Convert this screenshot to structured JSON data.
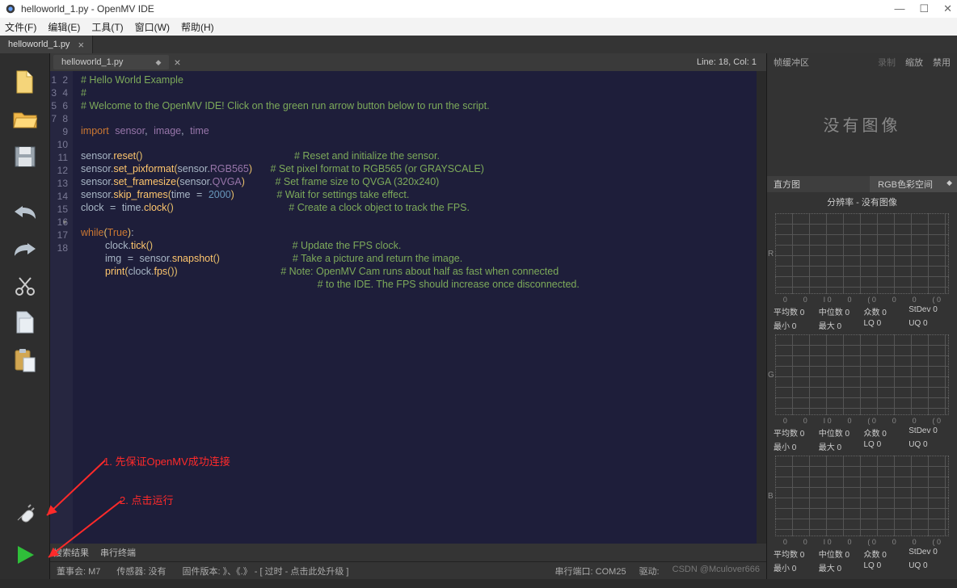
{
  "title": "helloworld_1.py - OpenMV IDE",
  "menu": {
    "file": "文件(F)",
    "edit": "编辑(E)",
    "tools": "工具(T)",
    "window": "窗口(W)",
    "help": "帮助(H)"
  },
  "tab": {
    "name": "helloworld_1.py"
  },
  "filehdr": {
    "name": "helloworld_1.py",
    "pos": "Line: 18, Col: 1"
  },
  "gutter_lines": [
    "1",
    "2",
    "3",
    "4",
    "5",
    "6",
    "7",
    "8",
    "9",
    "10",
    "11",
    "12",
    "13",
    "14",
    "15",
    "16",
    "17",
    "18"
  ],
  "code": {
    "l1": "# Hello World Example",
    "l2": "#",
    "l3": "# Welcome to the OpenMV IDE! Click on the green run arrow button below to run the script.",
    "l5_kw": "import",
    "l5_m1": "sensor",
    "l5_m2": "image",
    "l5_m3": "time",
    "l7": "sensor.reset()",
    "l7c": "# Reset and initialize the sensor.",
    "l8a": "sensor.set_pixformat(sensor.RGB565)",
    "l8c": "# Set pixel format to RGB565 (or GRAYSCALE)",
    "l9a": "sensor.set_framesize(sensor.QVGA)",
    "l9c": "# Set frame size to QVGA (320x240)",
    "l10a": "sensor.skip_frames(time = 2000)",
    "l10c": "# Wait for settings take effect.",
    "l11a": "clock = time.clock()",
    "l11c": "# Create a clock object to track the FPS.",
    "l13": "while(True):",
    "l14a": "    clock.tick()",
    "l14c": "# Update the FPS clock.",
    "l15a": "    img = sensor.snapshot()",
    "l15c": "# Take a picture and return the image.",
    "l16a": "    print(clock.fps())",
    "l16c": "# Note: OpenMV Cam runs about half as fast when connected",
    "l17c": "# to the IDE. The FPS should increase once disconnected."
  },
  "bottom": {
    "search": "搜索结果",
    "serial": "串行终端"
  },
  "footer": {
    "board": "董事会:   M7",
    "sensor": "传感器:  没有",
    "fw": "固件版本:  》、《.》 - [ 过时 - 点击此处升级 ]",
    "port": "串行端口:  COM25",
    "drive": "驱动:",
    "watermark": "CSDN @Mculover666"
  },
  "right": {
    "hdr_title": "帧缓冲区",
    "hdr_rec": "录制",
    "hdr_zoom": "缩放",
    "hdr_disable": "禁用",
    "noimg": "没有图像",
    "hist_l": "直方图",
    "hist_r": "RGB色彩空间",
    "res": "分辨率 - 没有图像",
    "axis": [
      "0",
      "0",
      "I 0",
      "0",
      "( 0",
      "0",
      "0",
      "( 0"
    ],
    "stats": {
      "mean": "平均数",
      "mean_v": "0",
      "median": "中位数",
      "median_v": "0",
      "mode": "众数",
      "mode_v": "0",
      "stdev": "StDev",
      "stdev_v": "0",
      "min": "最小",
      "min_v": "0",
      "max": "最大",
      "max_v": "0",
      "lq": "LQ",
      "lq_v": "0",
      "uq": "UQ",
      "uq_v": "0"
    }
  },
  "annot": {
    "a1": "1. 先保证OpenMV成功连接",
    "a2": "2. 点击运行"
  }
}
